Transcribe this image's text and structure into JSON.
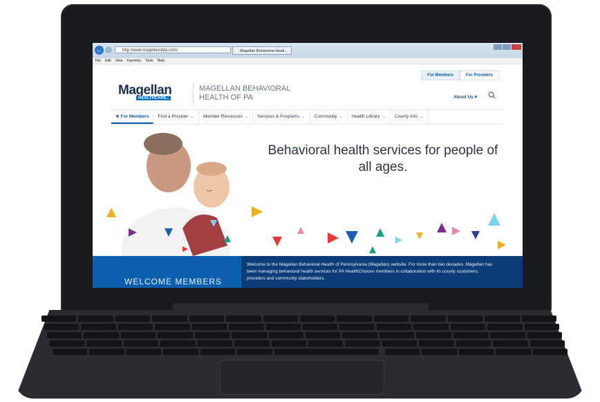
{
  "browser": {
    "url": "http://www.magellanofpa.com/",
    "tab_title": "Magellan Behavioral Healt...",
    "menu": [
      "File",
      "Edit",
      "View",
      "Favorites",
      "Tools",
      "Help"
    ]
  },
  "site": {
    "top_tabs": [
      "For Members",
      "For Providers"
    ],
    "logo_main": "Magellan",
    "logo_sub": "HEALTHCARE..",
    "name": "MAGELLAN BEHAVIORAL HEALTH OF PA",
    "about": "About Us ▾",
    "nav": [
      {
        "label": "For Members"
      },
      {
        "label": "Find a Provider"
      },
      {
        "label": "Member Resources"
      },
      {
        "label": "Services & Programs"
      },
      {
        "label": "Community"
      },
      {
        "label": "Health Library"
      },
      {
        "label": "County Info"
      }
    ],
    "hero_text": "Behavioral health services for people of all ages.",
    "welcome_title": "WELCOME MEMBERS",
    "welcome_text": "Welcome to the Magellan Behavioral Health of Pennsylvania (Magellan) website. For more than two decades, Magellan has been managing behavioral health services for PA HealthChoices members in collaboration with its county customers, providers and community stakeholders."
  },
  "colors": {
    "brand_blue": "#0c56a5",
    "dark_blue": "#0a3d78",
    "triangle_palette": [
      "#e7b320",
      "#e63a3a",
      "#7b2e8c",
      "#1f5cb0",
      "#14a085",
      "#e983b0",
      "#7fd3e8",
      "#2d3e8f"
    ]
  },
  "icons": {
    "search": "search-icon",
    "back": "back-arrow-icon"
  }
}
